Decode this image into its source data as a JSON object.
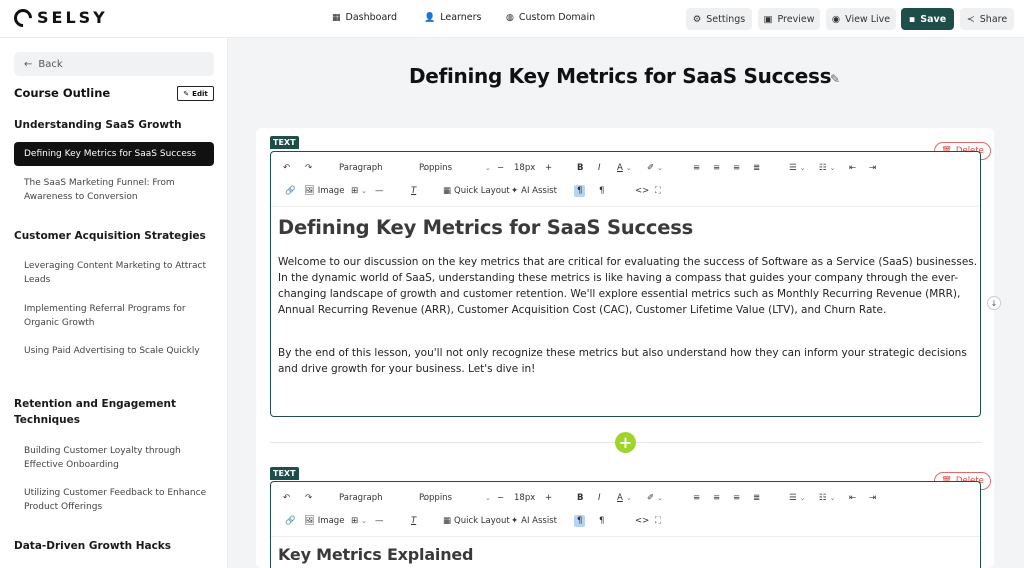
{
  "brand": {
    "name": "SELSY"
  },
  "nav": {
    "dashboard": "Dashboard",
    "learners": "Learners",
    "custom_domain": "Custom Domain"
  },
  "actions": {
    "settings": "Settings",
    "preview": "Preview",
    "view_live": "View Live",
    "save": "Save",
    "share": "Share"
  },
  "sidebar": {
    "back": "Back",
    "outline_title": "Course Outline",
    "edit": "Edit",
    "sections": [
      {
        "title": "Understanding SaaS Growth",
        "lessons": [
          "Defining Key Metrics for SaaS Success",
          "The SaaS Marketing Funnel: From Awareness to Conversion"
        ]
      },
      {
        "title": "Customer Acquisition Strategies",
        "lessons": [
          "Leveraging Content Marketing to Attract Leads",
          "Implementing Referral Programs for Organic Growth",
          "Using Paid Advertising to Scale Quickly"
        ]
      },
      {
        "title": "Retention and Engagement Techniques",
        "lessons": [
          "Building Customer Loyalty through Effective Onboarding",
          "Utilizing Customer Feedback to Enhance Product Offerings"
        ]
      },
      {
        "title": "Data-Driven Growth Hacks",
        "lessons": []
      }
    ]
  },
  "main": {
    "lesson_title": "Defining Key Metrics for SaaS Success"
  },
  "toolbar": {
    "paragraph": "Paragraph",
    "font": "Poppins",
    "size": "18px",
    "image": "Image",
    "quick_layout": "Quick Layout",
    "ai_assist": "AI Assist"
  },
  "blocks": [
    {
      "tag": "TEXT",
      "delete": "Delete",
      "heading": "Defining Key Metrics for SaaS Success",
      "paragraphs": [
        "Welcome to our discussion on the key metrics that are critical for evaluating the success of Software as a Service (SaaS) businesses. In the dynamic world of SaaS, understanding these metrics is like having a compass that guides your company through the ever-changing landscape of growth and customer retention. We'll explore essential metrics such as Monthly Recurring Revenue (MRR), Annual Recurring Revenue (ARR), Customer Acquisition Cost (CAC), Customer Lifetime Value (LTV), and Churn Rate.",
        "By the end of this lesson, you'll not only recognize these metrics but also understand how they can inform your strategic decisions and drive growth for your business. Let's dive in!"
      ]
    },
    {
      "tag": "TEXT",
      "delete": "Delete",
      "heading": "Key Metrics Explained"
    }
  ],
  "colors": {
    "accent": "#1f4e4a",
    "add": "#9fd52b",
    "delete": "#e04848"
  }
}
